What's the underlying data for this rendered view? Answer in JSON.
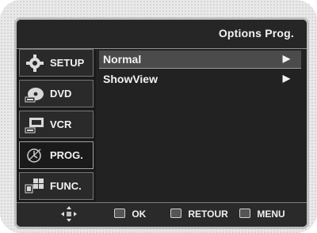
{
  "window": {
    "title": "Options Prog."
  },
  "sidebar": {
    "items": [
      {
        "label": "SETUP",
        "icon": "gear-icon"
      },
      {
        "label": "DVD",
        "icon": "dvd-icon"
      },
      {
        "label": "VCR",
        "icon": "vcr-icon"
      },
      {
        "label": "PROG.",
        "icon": "clock-icon",
        "active": true
      },
      {
        "label": "FUNC.",
        "icon": "func-icon"
      }
    ]
  },
  "menu": {
    "items": [
      {
        "label": "Normal",
        "arrow": "▶",
        "selected": true
      },
      {
        "label": "ShowView",
        "arrow": "▶"
      }
    ]
  },
  "footer": {
    "ok": "OK",
    "return": "RETOUR",
    "menu": "MENU"
  }
}
